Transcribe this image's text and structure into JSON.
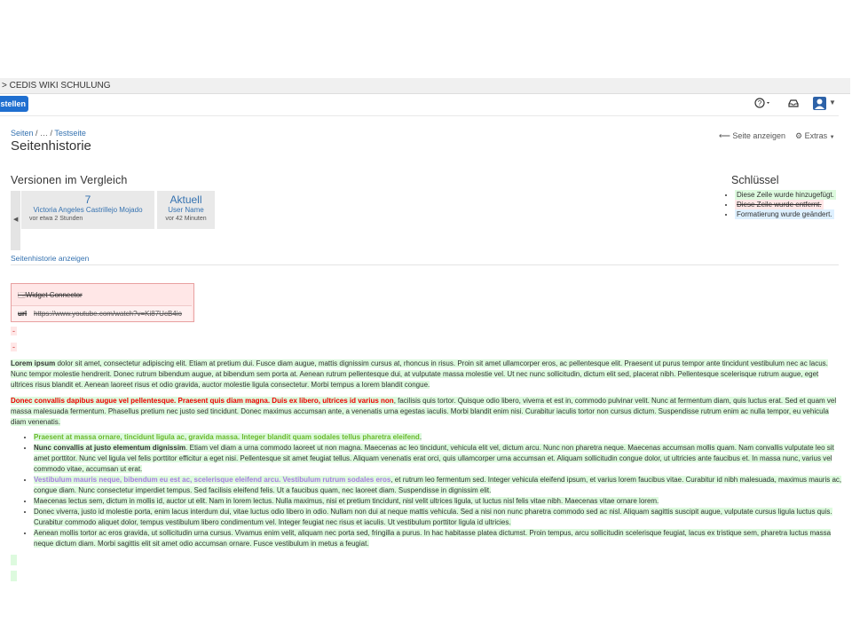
{
  "topbar": {
    "path": "> CEDIS WIKI SCHULUNG",
    "create_label": "stellen"
  },
  "header": {
    "help_icon": "help-icon",
    "inbox_icon": "inbox-icon",
    "avatar_icon": "user-avatar-icon"
  },
  "breadcrumb": {
    "item1": "Seiten",
    "sep1": " / ",
    "item2": "…",
    "sep2": " / ",
    "item3": "Testseite"
  },
  "page_title": "Seitenhistorie",
  "actions": {
    "view": "Seite anzeigen",
    "extras": "Extras"
  },
  "versions": {
    "title": "Versionen im Vergleich",
    "left": {
      "number": "7",
      "author": "Victoria Angeles Castrillejo Mojado",
      "time": "vor etwa 2 Stunden"
    },
    "right": {
      "number": "Aktuell",
      "author": "User Name",
      "time": "vor 42 Minuten"
    },
    "history_link": "Seitenhistorie anzeigen"
  },
  "key": {
    "title": "Schlüssel",
    "added": "Diese Zeile wurde hinzugefügt.",
    "removed": "Diese Zeile wurde entfernt.",
    "formatted": "Formatierung wurde geändert."
  },
  "widget": {
    "title": "Widget Connector",
    "key": "url",
    "value": "https://www.youtube.com/watch?v=Ki87UcB4io"
  },
  "dash1": "-",
  "dash2": "-",
  "content": {
    "p1_bold": "Lorem ipsum",
    "p1_text": " dolor sit amet, consectetur adipiscing elit. Etiam at pretium dui. Fusce diam augue, mattis dignissim cursus at, rhoncus in risus. Proin sit amet ullamcorper eros, ac pellentesque elit. Praesent ut purus tempor ante tincidunt vestibulum nec ac lacus. Nunc tempor molestie hendrerit. Donec rutrum bibendum augue, at bibendum sem porta at. Aenean rutrum pellentesque dui, at vulputate massa molestie vel. Ut nec nunc sollicitudin, dictum elit sed, placerat nibh. Pellentesque scelerisque rutrum augue, eget ultrices risus blandit et. Aenean laoreet risus et odio gravida, auctor molestie ligula consectetur. Morbi tempus a lorem blandit congue.",
    "p2_red": "Donec convallis dapibus augue vel pellentesque. Praesent quis diam magna. Duis ex libero, ultrices id varius non",
    "p2_text": ", facilisis quis tortor. Quisque odio libero, viverra et est in, commodo pulvinar velit. Nunc at fermentum diam, quis luctus erat. Sed et quam vel massa malesuada fermentum. Phasellus pretium nec justo sed tincidunt. Donec maximus accumsan ante, a venenatis urna egestas iaculis. Morbi blandit enim nisi. Curabitur iaculis tortor non cursus dictum. Suspendisse rutrum enim ac nulla tempor, eu vehicula diam venenatis.",
    "b1_green": "Praesent at massa ornare, tincidunt ligula ac, gravida massa. Integer blandit quam sodales tellus pharetra eleifend",
    "b1_text": ".",
    "b2_bold": "Nunc convallis at justo elementum dignissim",
    "b2_text": ". Etiam vel diam a urna commodo laoreet ut non magna. Maecenas ac leo tincidunt, vehicula elit vel, dictum arcu. Nunc non pharetra neque. Maecenas accumsan mollis quam. Nam convallis vulputate leo sit amet porttitor. Nunc vel ligula vel felis porttitor efficitur a eget nisi. Pellentesque sit amet feugiat tellus. Aliquam venenatis erat orci, quis ullamcorper urna accumsan et. Aliquam sollicitudin congue dolor, ut ultricies ante faucibus et. In massa nunc, varius vel commodo vitae, accumsan ut erat.",
    "b3_purple": "Vestibulum mauris neque, bibendum eu est ac, scelerisque eleifend arcu. Vestibulum rutrum sodales eros",
    "b3_text": ", et rutrum leo fermentum sed. Integer vehicula eleifend ipsum, et varius lorem faucibus vitae. Curabitur id nibh malesuada, maximus mauris ac, congue diam. Nunc consectetur imperdiet tempus. Sed facilisis eleifend felis. Ut a faucibus quam, nec laoreet diam. Suspendisse in dignissim elit.",
    "b4": "Maecenas lectus sem, dictum in mollis id, auctor ut elit. Nam in lorem lectus. Nulla maximus, nisi et pretium tincidunt, nisl velit ultrices ligula, ut luctus nisl felis vitae nibh. Maecenas vitae ornare lorem.",
    "b5": "Donec viverra, justo id molestie porta, enim lacus interdum dui, vitae luctus odio libero in odio. Nullam non dui at neque mattis vehicula. Sed a nisi non nunc pharetra commodo sed ac nisl. Aliquam sagittis suscipit augue, vulputate cursus ligula luctus quis. Curabitur commodo aliquet dolor, tempus vestibulum libero condimentum vel. Integer feugiat nec risus et iaculis. Ut vestibulum porttitor ligula id ultricies.",
    "b6": "Aenean mollis tortor ac eros gravida, ut sollicitudin urna cursus. Vivamus enim velit, aliquam nec porta sed, fringilla a purus. In hac habitasse platea dictumst. Proin tempus, arcu sollicitudin scelerisque feugiat, lacus ex tristique sem, pharetra luctus massa neque dictum diam. Morbi sagittis elit sit amet odio accumsan ornare. Fusce vestibulum in metus a feugiat."
  },
  "colors": {
    "added": "#ddfade",
    "removed": "#ffe7e7",
    "formatted": "#def0ff",
    "link": "#3572b0"
  }
}
